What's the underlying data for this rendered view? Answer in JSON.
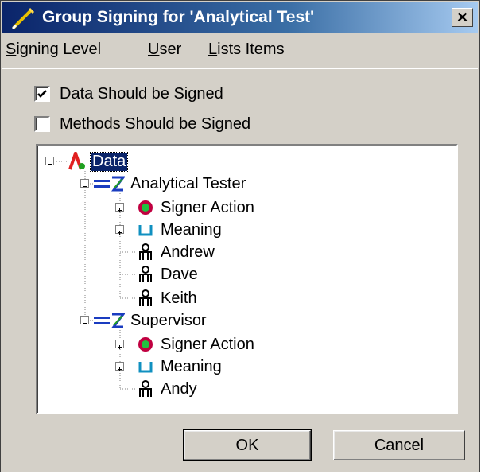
{
  "window": {
    "title": "Group Signing for 'Analytical Test'",
    "close_glyph": "✕"
  },
  "menu": [
    {
      "mnemonic": "S",
      "rest": "igning Level"
    },
    {
      "mnemonic": "U",
      "rest": "ser"
    },
    {
      "mnemonic": "L",
      "rest": "ists Items"
    }
  ],
  "checks": [
    {
      "label": "Data Should be Signed",
      "checked": true
    },
    {
      "label": "Methods Should be Signed",
      "checked": false
    }
  ],
  "tree": {
    "root": {
      "label": "Data",
      "icon": "data-icon",
      "selected": true
    },
    "groups": [
      {
        "label": "Analytical Tester",
        "icon": "signing-level-icon",
        "children": [
          {
            "label": "Signer Action",
            "icon": "signer-action-icon",
            "expandable": true
          },
          {
            "label": "Meaning",
            "icon": "meaning-icon",
            "expandable": true
          },
          {
            "label": "Andrew",
            "icon": "user-icon",
            "expandable": false
          },
          {
            "label": "Dave",
            "icon": "user-icon",
            "expandable": false
          },
          {
            "label": "Keith",
            "icon": "user-icon",
            "expandable": false
          }
        ]
      },
      {
        "label": "Supervisor",
        "icon": "signing-level-icon",
        "children": [
          {
            "label": "Signer Action",
            "icon": "signer-action-icon",
            "expandable": true
          },
          {
            "label": "Meaning",
            "icon": "meaning-icon",
            "expandable": true
          },
          {
            "label": "Andy",
            "icon": "user-icon",
            "expandable": false
          }
        ]
      }
    ]
  },
  "buttons": {
    "ok": "OK",
    "cancel": "Cancel"
  }
}
